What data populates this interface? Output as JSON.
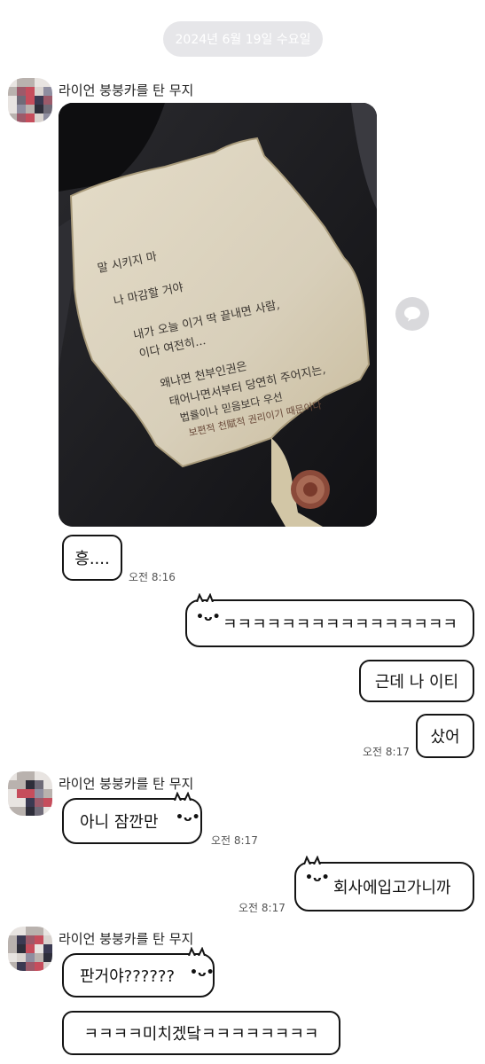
{
  "date_divider": "2024년 6월 19일 수요일",
  "messages": [
    {
      "sender": "라이언 붕붕카를 탄 무지",
      "text": "흥....",
      "time": "오전 8:16"
    },
    {
      "text": "ㅋㅋㅋㅋㅋㅋㅋㅋㅋㅋㅋㅋㅋㅋㅋㅋ"
    },
    {
      "text": "근데 나 이티"
    },
    {
      "text": "샀어",
      "time": "오전 8:17"
    },
    {
      "sender": "라이언 붕붕카를 탄 무지",
      "text": "아니 잠깐만",
      "time": "오전 8:17"
    },
    {
      "text": "회사에입고가니까",
      "time": "오전 8:17"
    },
    {
      "sender": "라이언 붕붕카를 탄 무지",
      "text": "판거야??????"
    },
    {
      "text": "ㅋㅋㅋㅋ미치겠닼ㅋㅋㅋㅋㅋㅋㅋㅋ"
    }
  ],
  "photo": {
    "lines": [
      "말 시키지 마",
      "나 마감할 거야",
      "내가 오늘 이거 딱 끝내면 사람,",
      "이다 여전히...",
      "왜냐면 천부인권은",
      "태어나면서부터 당연히 주어지는,",
      "법률이나 믿음보다 우선",
      "보편적 천賦적 권리이기 때문이다"
    ]
  },
  "icons": {
    "share": "share-speech-bubble-icon",
    "avatar": "pixelated-avatar"
  }
}
